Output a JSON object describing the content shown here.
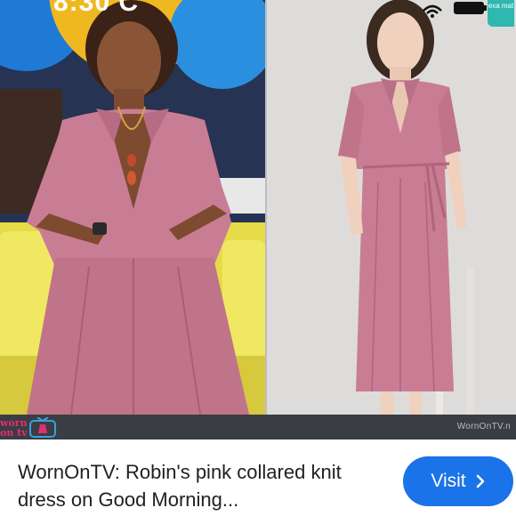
{
  "status_bar": {
    "time": "8:30 C"
  },
  "image": {
    "left_panel": "Robin Roberts on Good Morning America set",
    "right_panel": "model wearing pink collared knit dress",
    "logo_text": "worn on tv",
    "credit": "WornOnTV.n",
    "badge": "exa mat"
  },
  "result": {
    "title": "WornOnTV: Robin's pink collared knit dress on Good Morning...",
    "visit_label": "Visit"
  },
  "colors": {
    "dress_pink": "#c97d94",
    "sofa_yellow": "#e9df4c",
    "button_blue": "#1a73e8",
    "logo_pink": "#e1306c"
  },
  "icons": [
    "wifi-icon",
    "battery-icon",
    "chevron-right-icon",
    "tv-icon"
  ]
}
